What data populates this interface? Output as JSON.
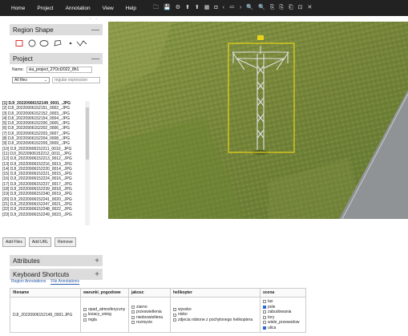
{
  "menu": [
    "Home",
    "Project",
    "Annotation",
    "View",
    "Help"
  ],
  "toolbar_icons": [
    "folder-icon",
    "save-icon",
    "gear-icon",
    "upload-icon",
    "download-icon",
    "grid-icon",
    "gallery-icon",
    "prev-icon",
    "list-icon",
    "next-icon",
    "zoom-in-icon",
    "zoom-out-icon",
    "copy-icon",
    "paste-icon",
    "delete-icon",
    "select-icon",
    "close-icon"
  ],
  "toolbar_glyphs": [
    "🗀",
    "💾",
    "⚙",
    "⬆",
    "⬆",
    "▦",
    "◘",
    "‹",
    "≔",
    "›",
    "🔍",
    "🔍",
    "⎘",
    "⎘",
    "⎗",
    "⊡",
    "✕"
  ],
  "sidebar": {
    "region_shape": {
      "title": "Region Shape",
      "toggle": "—"
    },
    "project": {
      "title": "Project",
      "toggle": "—",
      "name_label": "Name:",
      "name_value": "via_project_27Oct2022_8h1",
      "filter_select": "All files",
      "filter_placeholder": "regular expression",
      "files": [
        "[1] DJI_20220906152149_0001_.JPG",
        "[2] DJI_20220906152151_0002_.JPG",
        "[3] DJI_20220906152152_0003_.JPG",
        "[4] DJI_20220906152154_0004_.JPG",
        "[5] DJI_20220906152200_0005_.JPG",
        "[6] DJI_20220906152202_0006_.JPG",
        "[7] DJI_20220906152203_0007_.JPG",
        "[8] DJI_20220906152204_0008_.JPG",
        "[9] DJI_20220906152209_0009_.JPG",
        "[10] DJI_20220906152211_0010_.JPG",
        "[11] DJI_20220906152212_0011_.JPG",
        "[12] DJI_20220906152213_0012_.JPG",
        "[13] DJI_20220906152216_0013_.JPG",
        "[14] DJI_20220906152220_0014_.JPG",
        "[15] DJI_20220906152221_0015_.JPG",
        "[16] DJI_20220906152224_0016_.JPG",
        "[17] DJI_20220906152237_0017_.JPG",
        "[18] DJI_20220906152239_0018_.JPG",
        "[19] DJI_20220906152240_0019_.JPG",
        "[20] DJI_20220906152241_0020_.JPG",
        "[21] DJI_20220906152247_0021_.JPG",
        "[22] DJI_20220906152248_0022_.JPG",
        "[23] DJI_20220906152249_0023_.JPG"
      ],
      "buttons": {
        "add_files": "Add Files",
        "add_url": "Add URL",
        "remove": "Remove"
      }
    },
    "attributes": {
      "title": "Attributes",
      "toggle": "+"
    },
    "keyboard": {
      "title": "Keyboard Shortcuts",
      "toggle": "+"
    }
  },
  "bottom": {
    "tabs": [
      "Region Annotations",
      "File Annotations"
    ],
    "headers": [
      "filename",
      "warunki_pogodowe",
      "jakosc",
      "helikopter",
      "scena"
    ],
    "filename": "DJI_20220906152149_0001.JPG",
    "warunki": [
      {
        "label": "opad_atmosferyczny",
        "checked": false
      },
      {
        "label": "lezacy_snieg",
        "checked": false
      },
      {
        "label": "mgla",
        "checked": false
      }
    ],
    "jakosc": [
      {
        "label": "ziarno",
        "checked": false
      },
      {
        "label": "przeswietlenia",
        "checked": false
      },
      {
        "label": "niedoswietlena",
        "checked": false
      },
      {
        "label": "rozmycie",
        "checked": false
      }
    ],
    "helikopter": [
      {
        "label": "wysoko",
        "checked": false
      },
      {
        "label": "nisko",
        "checked": false
      },
      {
        "label": "zdjecia robione z pochylonego helikoptera",
        "checked": false
      }
    ],
    "scena": [
      {
        "label": "las",
        "checked": false
      },
      {
        "label": "pole",
        "checked": true
      },
      {
        "label": "zabudowania",
        "checked": false
      },
      {
        "label": "tory",
        "checked": false
      },
      {
        "label": "wiele_przewodow",
        "checked": false
      },
      {
        "label": "ulica",
        "checked": true
      }
    ]
  },
  "colors": {
    "topbar": "#222222",
    "panel_header": "#dcdcdc",
    "bbox": "#e8d21a",
    "road": "#8f9396",
    "field": "#7c8a3c"
  }
}
